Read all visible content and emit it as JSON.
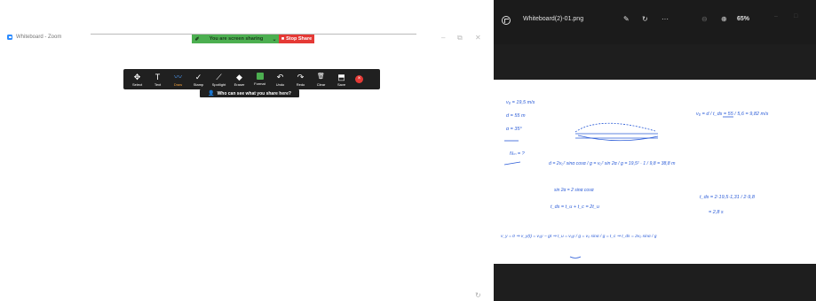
{
  "zoom": {
    "window_title": "Whiteboard - Zoom",
    "share_status": "You are screen sharing",
    "stop_label": "Stop Share",
    "tools": [
      {
        "label": "Select",
        "icon": "✥"
      },
      {
        "label": "Text",
        "icon": "T"
      },
      {
        "label": "Draw",
        "icon": "〰"
      },
      {
        "label": "Stamp",
        "icon": "✓"
      },
      {
        "label": "Spotlight",
        "icon": "⟋"
      },
      {
        "label": "Eraser",
        "icon": "◆"
      },
      {
        "label": "Format",
        "icon": ""
      },
      {
        "label": "Undo",
        "icon": "↶"
      },
      {
        "label": "Redo",
        "icon": "↷"
      },
      {
        "label": "Clear",
        "icon": "🗑"
      },
      {
        "label": "Save",
        "icon": "⬒"
      }
    ],
    "who_can_see": "Who can see what you share here?"
  },
  "viewer": {
    "filename": "Whiteboard(2)-01.png",
    "zoom_level": "65%"
  },
  "colors": {
    "share_green": "#4caf50",
    "stop_red": "#e53935",
    "ink_blue": "#2a5bd7",
    "toolbar_bg": "#202020",
    "viewer_bg": "#1e1e1e"
  },
  "whiteboard": {
    "lines": [
      "v₀ = 19,5 m/s",
      "d = 55 m",
      "α = 35°",
      "Nₘ = ?",
      "v₀ = d / t_ds = 55 / 5,6 = 9,82 m/s",
      "d = 2v₀² sinα cosα / g = v₀² sin 2α / g = 19,5² · 1 / 9,8 = 38,8 m",
      "sin 2α = 2 sinα cosα",
      "t_ds = t_u + t_c = 2t_u",
      "t_ds = 2·19,5·1,31 / 2·9,8",
      "= 2,8 s",
      "v_y = 0 ⇒ v_y(t) = v₀y − gt ⇒ t_u = v₀y / g = v₀ sinα / g = t_c ⇒ t_ds = 2v₀ sinα / g"
    ]
  }
}
